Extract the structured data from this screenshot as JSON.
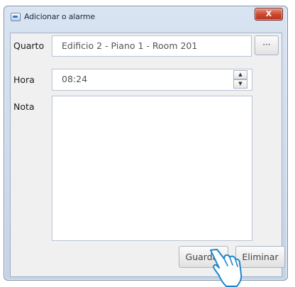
{
  "window": {
    "title": "Adicionar o alarme",
    "app_icon": "alarm-app-icon",
    "close_icon": "close-icon",
    "close_glyph": "X"
  },
  "form": {
    "quarto_label": "Quarto",
    "quarto_value": "Edificio 2 - Piano 1 - Room 201",
    "browse_label": "···",
    "hora_label": "Hora",
    "hora_value": "08:24",
    "spin_up": "▲",
    "spin_down": "▼",
    "nota_label": "Nota",
    "nota_value": ""
  },
  "buttons": {
    "save_label": "Guardar",
    "delete_label": "Eliminar"
  },
  "overlay": {
    "cursor": "hand-pointer-icon"
  },
  "colors": {
    "title_bar": "#c9d7ea",
    "close_button": "#c8432d",
    "dialog_bg": "#f0f0f0"
  }
}
